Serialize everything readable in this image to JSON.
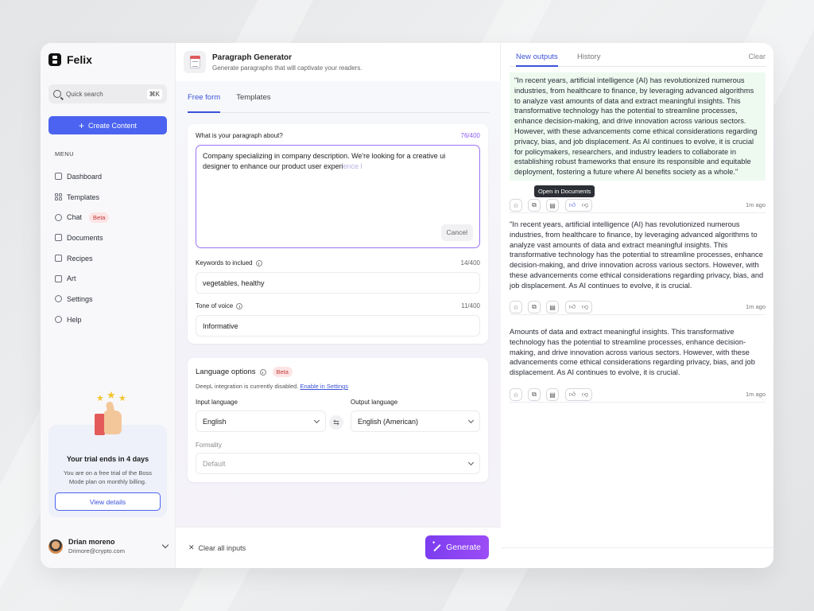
{
  "app": {
    "name": "Felix"
  },
  "sidebar": {
    "search_label": "Quick search",
    "search_shortcut": "⌘K",
    "create_label": "Create Content",
    "menu_title": "MENU",
    "items": [
      {
        "label": "Dashboard",
        "icon": "home-icon"
      },
      {
        "label": "Templates",
        "icon": "grid-icon"
      },
      {
        "label": "Chat",
        "icon": "chat-icon",
        "badge": "Beta"
      },
      {
        "label": "Documents",
        "icon": "document-icon"
      },
      {
        "label": "Recipes",
        "icon": "recipe-icon"
      },
      {
        "label": "Art",
        "icon": "image-icon"
      },
      {
        "label": "Settings",
        "icon": "gear-icon"
      },
      {
        "label": "Help",
        "icon": "help-icon"
      }
    ],
    "trial": {
      "title": "Your trial ends in 4 days",
      "desc": "You are on a free trial of the Boss Mode plan on monthly billing.",
      "button": "View details"
    },
    "user": {
      "name": "Drian moreno",
      "email": "Drimore@crypto.com"
    }
  },
  "generator": {
    "title": "Paragraph Generator",
    "subtitle": "Generate paragraphs that will captivate your readers.",
    "tabs": [
      "Free form",
      "Templates"
    ],
    "about_label": "What is your paragraph about?",
    "about_count": "76/400",
    "about_text": "Company specializing in company description. We're looking for a creative ui designer to enhance our product user experi",
    "about_ghost": "ence l",
    "cancel_label": "Cancel",
    "keywords_label": "Keywords to inclued",
    "keywords_count": "14/400",
    "keywords_value": "vegetables, healthy",
    "tone_label": "Tone of voice",
    "tone_count": "11/400",
    "tone_value": "Informative",
    "lang_title": "Language options",
    "lang_badge": "Beta",
    "deepl_text": "DeepL integration is currently disabled.",
    "deepl_link": "Enable in Settings",
    "input_lang_label": "Input language",
    "input_lang_value": "English",
    "output_lang_label": "Output language",
    "output_lang_value": "English (American)",
    "formality_label": "Formality",
    "formality_value": "Default",
    "clear_label": "Clear all inputs",
    "generate_label": "Generate"
  },
  "outputs": {
    "tabs": [
      "New outputs",
      "History"
    ],
    "clear_label": "Clear",
    "tooltip": "Open in Documents",
    "items": [
      {
        "text": "\"In recent years, artificial intelligence (AI) has revolutionized numerous industries, from healthcare to finance, by leveraging advanced algorithms to analyze vast amounts of data and extract meaningful insights. This transformative technology has the potential to streamline processes, enhance decision-making, and drive innovation across various sectors. However, with these advancements come ethical considerations regarding privacy, bias, and job displacement. As AI continues to evolve, it is crucial for policymakers, researchers, and industry leaders to collaborate in establishing robust frameworks that ensure its responsible and equitable deployment, fostering a future where AI benefits society as a whole.\"",
        "time": "1m ago"
      },
      {
        "text": "\"In recent years, artificial intelligence (AI) has revolutionized numerous industries, from healthcare to finance, by leveraging advanced algorithms to analyze vast amounts of data and extract meaningful insights. This transformative technology has the potential to streamline processes, enhance decision-making, and drive innovation across various sectors. However, with these advancements come ethical considerations regarding privacy, bias, and job displacement. As AI continues to evolve, it is crucial.",
        "time": "1m ago"
      },
      {
        "text": "Amounts of data and extract meaningful insights. This transformative technology has the potential to streamline processes, enhance decision-making, and drive innovation across various sectors. However, with these advancements come ethical considerations regarding privacy, bias, and job displacement. As AI continues to evolve, it is crucial.",
        "time": "1m ago"
      }
    ]
  },
  "colors": {
    "accent": "#4b63f0",
    "generate": "#8a47f3",
    "beta_bg": "#fde4e4",
    "beta_text": "#c23a3a",
    "highlight": "#eefaf0"
  }
}
